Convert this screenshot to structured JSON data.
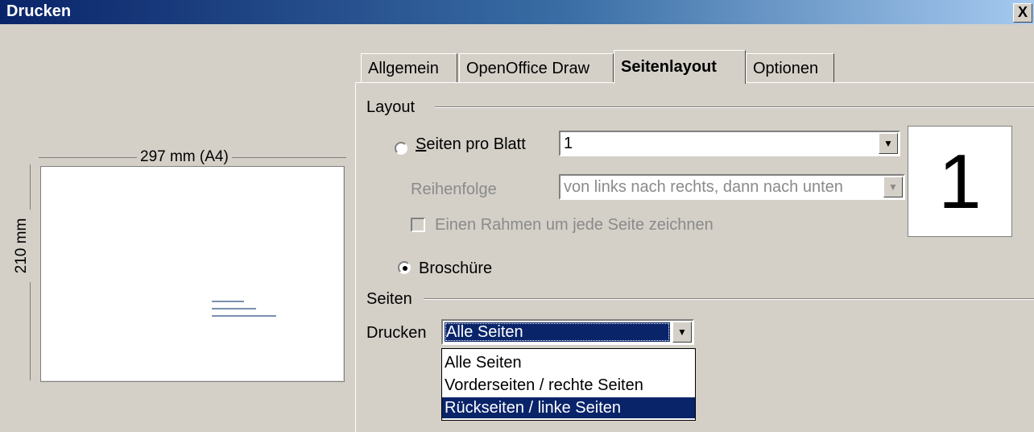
{
  "window": {
    "title": "Drucken",
    "close_label": "X"
  },
  "preview": {
    "width_label": "297 mm (A4)",
    "height_label": "210 mm"
  },
  "tabs": [
    {
      "label": "Allgemein",
      "active": false
    },
    {
      "label": "OpenOffice Draw",
      "active": false
    },
    {
      "label": "Seitenlayout",
      "active": true
    },
    {
      "label": "Optionen",
      "active": false
    }
  ],
  "layout": {
    "group_title": "Layout",
    "pages_per_sheet": {
      "label": "Seiten pro Blatt",
      "selected": false,
      "value": "1"
    },
    "order": {
      "label": "Reihenfolge",
      "value": "von links nach rechts, dann nach unten",
      "enabled": false
    },
    "border": {
      "label": "Einen Rahmen um jede Seite zeichnen",
      "checked": false,
      "enabled": false
    },
    "brochure": {
      "label": "Broschüre",
      "selected": true
    },
    "preview_number": "1"
  },
  "pages": {
    "group_title": "Seiten",
    "print_label": "Drucken",
    "print_value": "Alle Seiten",
    "options": [
      "Alle Seiten",
      "Vorderseiten / rechte Seiten",
      "Rückseiten / linke Seiten"
    ],
    "highlighted_option": "Rückseiten / linke Seiten"
  }
}
